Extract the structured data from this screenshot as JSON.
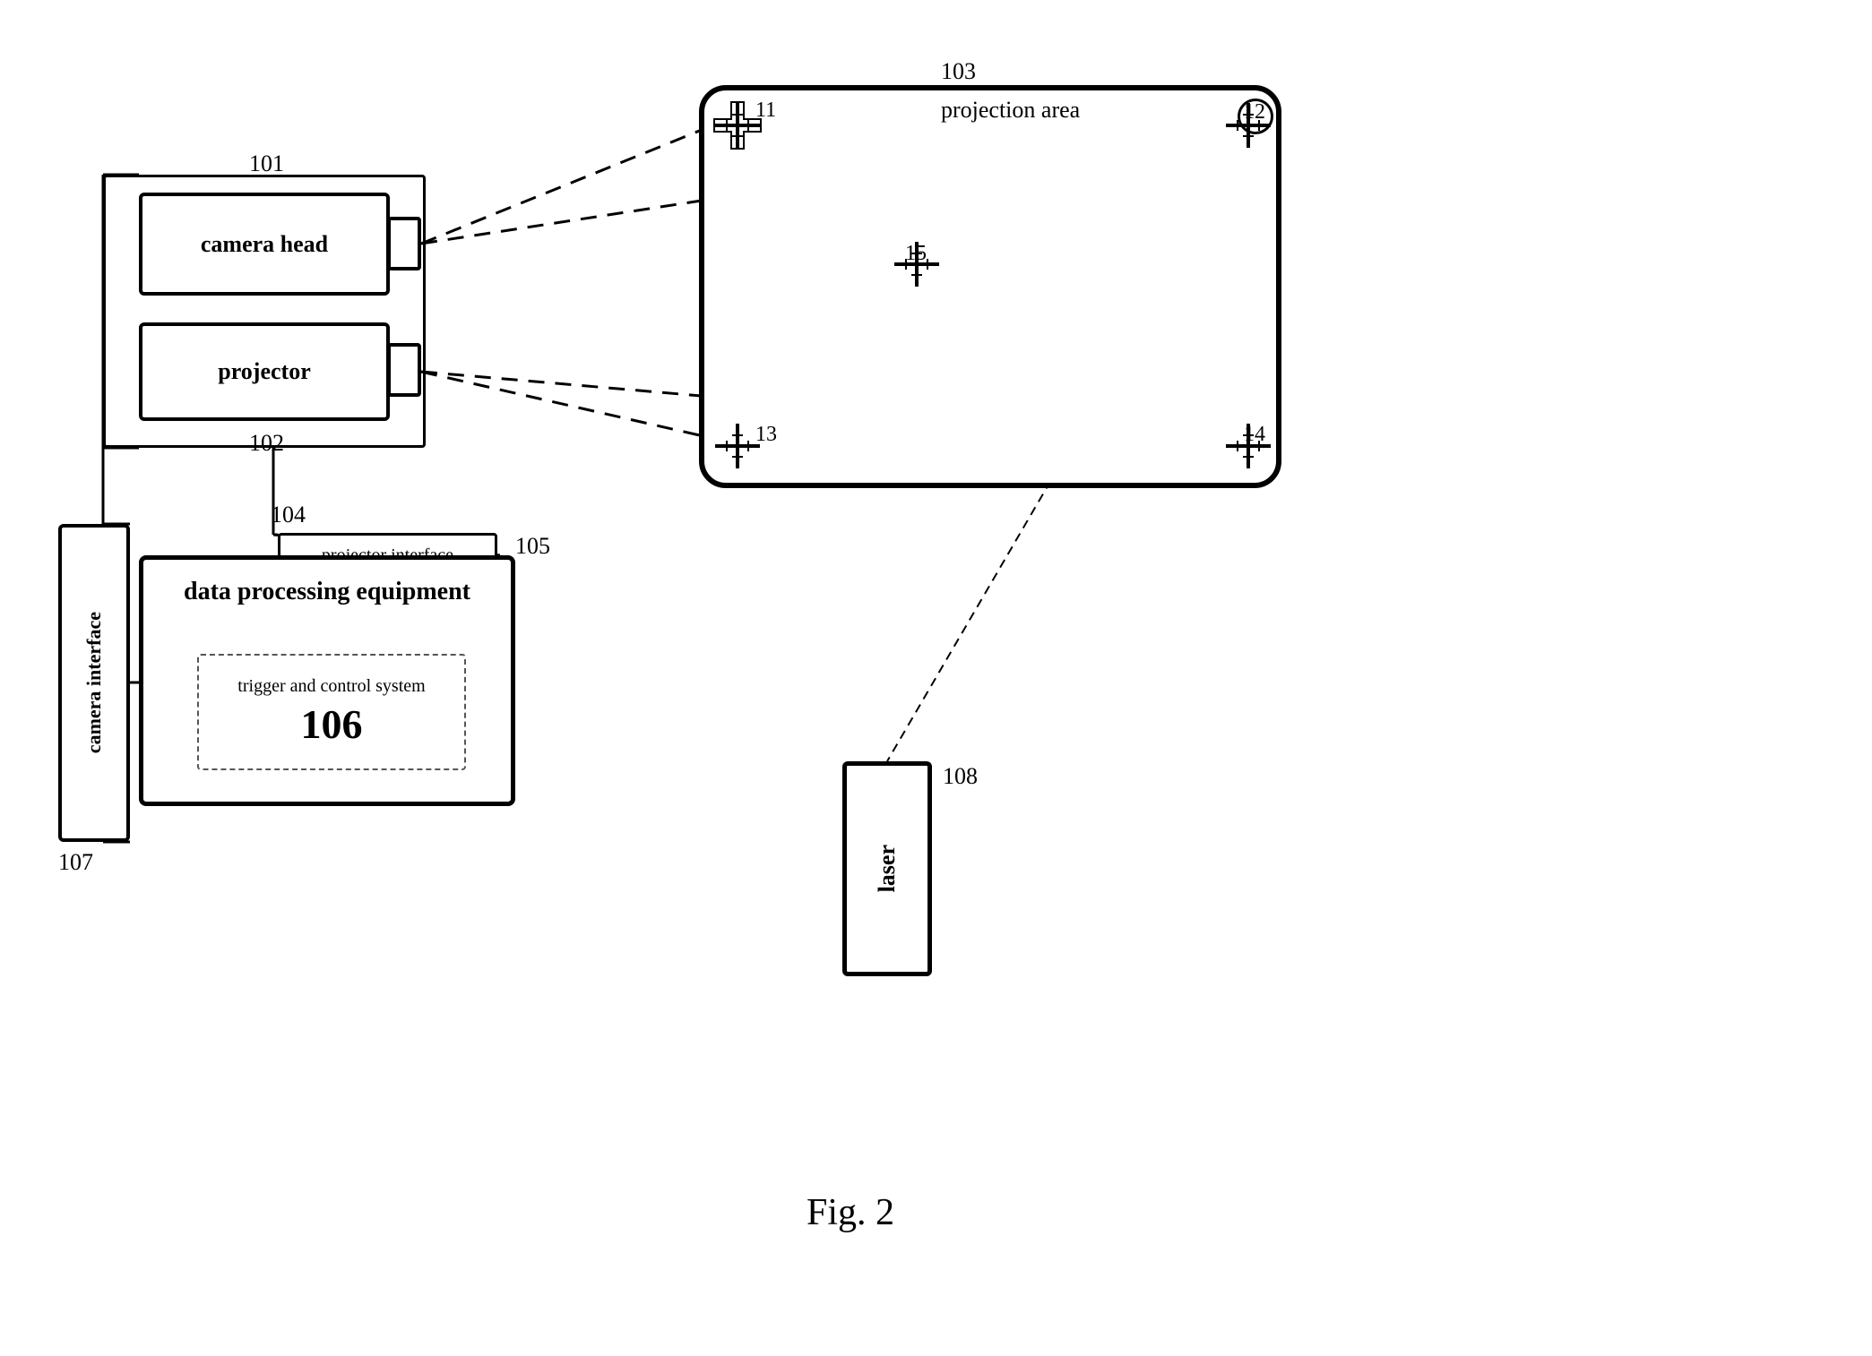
{
  "diagram": {
    "title": "Fig. 2",
    "labels": {
      "camera_head": "camera head",
      "projector": "projector",
      "data_processing_equipment": "data processing equipment",
      "trigger_and_control": "trigger and control system",
      "trigger_number": "106",
      "projector_interface": "projector interface",
      "camera_interface": "camera interface",
      "projection_area": "projection area",
      "laser": "laser",
      "ref_101": "101",
      "ref_102": "102",
      "ref_103": "103",
      "ref_104": "104",
      "ref_105": "105",
      "ref_107": "107",
      "ref_108": "108",
      "ref_11": "11",
      "ref_12": "12",
      "ref_13": "13",
      "ref_14": "14",
      "ref_15": "15",
      "fig": "Fig. 2"
    }
  }
}
